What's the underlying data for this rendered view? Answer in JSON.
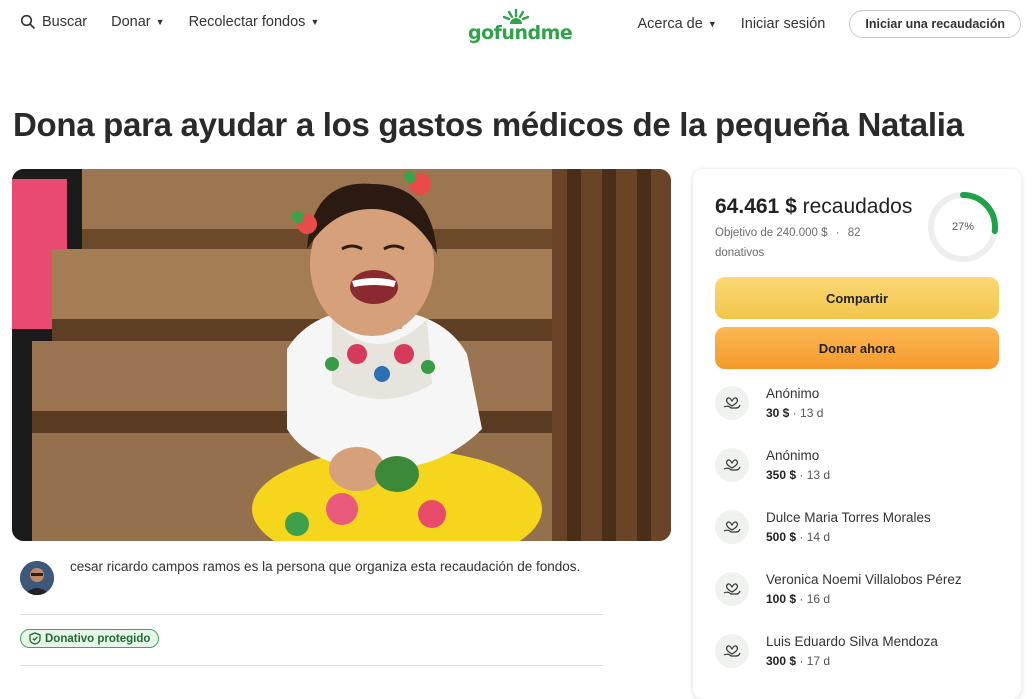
{
  "nav": {
    "search_label": "Buscar",
    "donate_label": "Donar",
    "fundraise_label": "Recolectar fondos",
    "logo_text": "gofundme",
    "about_label": "Acerca de",
    "signin_label": "Iniciar sesión",
    "start_label": "Iniciar una recaudación"
  },
  "page": {
    "title": "Dona para ayudar a los gastos médicos de la pequeña Natalia"
  },
  "organizer": {
    "text": "cesar ricardo campos ramos es la persona que organiza esta recaudación de fondos.",
    "badge": "Donativo protegido"
  },
  "summary": {
    "raised_amount": "64.461 $",
    "raised_label": "recaudados",
    "goal_text": "Objetivo de 240.000 $",
    "separator": "·",
    "donations_count": "82 donativos",
    "progress_label": "27%",
    "progress_fraction": 0.27,
    "share_label": "Compartir",
    "donate_now_label": "Donar ahora"
  },
  "donations": [
    {
      "name": "Anónimo",
      "amount": "30 $",
      "time": "13 d"
    },
    {
      "name": "Anónimo",
      "amount": "350 $",
      "time": "13 d"
    },
    {
      "name": "Dulce Maria Torres Morales",
      "amount": "500 $",
      "time": "14 d"
    },
    {
      "name": "Veronica Noemi Villalobos Pérez",
      "amount": "100 $",
      "time": "16 d"
    },
    {
      "name": "Luis Eduardo Silva Mendoza",
      "amount": "300 $",
      "time": "17 d"
    }
  ],
  "colors": {
    "brand_green": "#2fa34a",
    "share_yellow": "#f2c64c",
    "donate_orange": "#f49a2c",
    "progress_green": "#1fa34a"
  },
  "icons": {
    "search": "search-icon",
    "caret": "chevron-down-icon",
    "shield": "shield-check-icon",
    "donation": "heart-hand-icon"
  }
}
